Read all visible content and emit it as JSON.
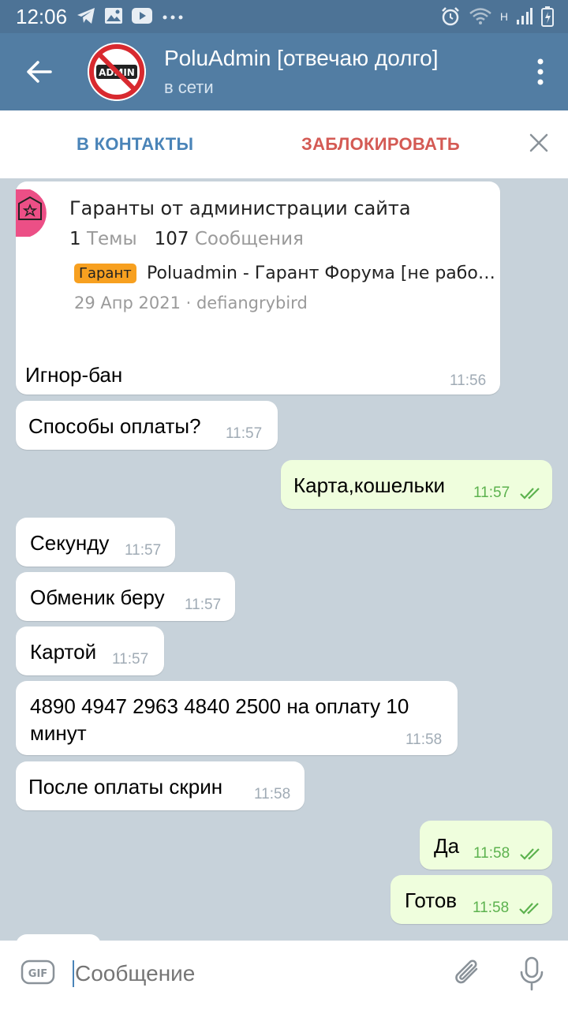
{
  "status_bar": {
    "time": "12:06",
    "left_icons": [
      "telegram-icon",
      "image-icon",
      "youtube-icon",
      "more-dots-icon"
    ],
    "right_icons": [
      "alarm-icon",
      "wifi-icon",
      "signal-icon",
      "battery-icon"
    ],
    "network_label": "H"
  },
  "header": {
    "title": "PoluAdmin [отвечаю долго]",
    "status": "в сети",
    "avatar_text": "ADMIN"
  },
  "action_bar": {
    "add_contact": "В КОНТАКТЫ",
    "block": "ЗАБЛОКИРОВАТЬ"
  },
  "preview": {
    "title": "Гаранты от администрации сайта",
    "topics_count": "1",
    "topics_label": "Темы",
    "messages_count": "107",
    "messages_label": "Сообщения",
    "badge": "Гарант",
    "thread_title": "Poluadmin - Гарант Форума [не работает]",
    "meta": "29 Апр 2021 · defiangrybird"
  },
  "messages": [
    {
      "text": "Игнор-бан",
      "time": "11:56",
      "dir": "in"
    },
    {
      "text": "Способы оплаты?",
      "time": "11:57",
      "dir": "in"
    },
    {
      "text": "Карта,кошельки",
      "time": "11:57",
      "dir": "out"
    },
    {
      "text": "Секунду",
      "time": "11:57",
      "dir": "in"
    },
    {
      "text": "Обменик беру",
      "time": "11:57",
      "dir": "in"
    },
    {
      "text": "Картой",
      "time": "11:57",
      "dir": "in"
    },
    {
      "text_line1": "4890 4947 2963 4840 2500 на оплату 10",
      "text_line2": "минут",
      "time": "11:58",
      "dir": "in"
    },
    {
      "text": "После оплаты скрин",
      "time": "11:58",
      "dir": "in"
    },
    {
      "text": "Да",
      "time": "11:58",
      "dir": "out"
    },
    {
      "text": "Готов",
      "time": "11:58",
      "dir": "out"
    }
  ],
  "input": {
    "placeholder": "Сообщение",
    "gif_label": "GIF"
  },
  "colors": {
    "header": "#527da3",
    "status_bar": "#4d7396",
    "chat_background": "#c7d2da",
    "outgoing_bubble": "#effedd",
    "incoming_bubble": "#ffffff",
    "accent_blue": "#4a84b8",
    "block_red": "#d45a54",
    "badge_orange": "#f7a020"
  }
}
